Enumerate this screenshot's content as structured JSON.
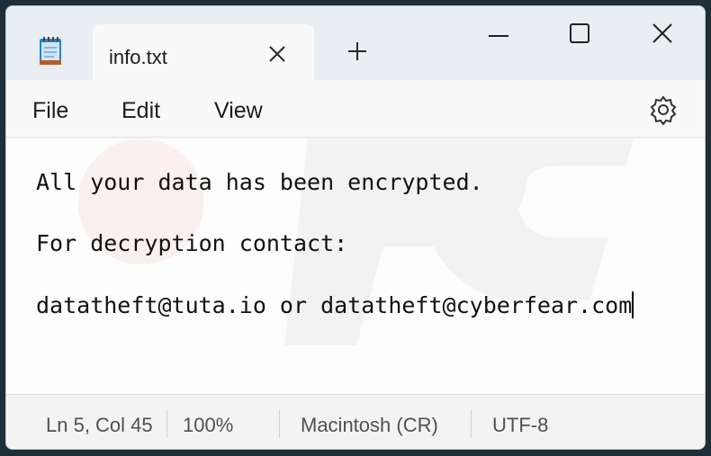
{
  "window": {
    "tab_title": "info.txt",
    "icons": {
      "app": "notepad-icon",
      "close_tab": "close-icon",
      "new_tab": "plus-icon",
      "minimize": "minimize-icon",
      "maximize": "maximize-icon",
      "close_window": "close-icon"
    }
  },
  "menu": {
    "file": "File",
    "edit": "Edit",
    "view": "View",
    "settings_icon": "gear-icon"
  },
  "document": {
    "lines": [
      "All your data has been encrypted.",
      "For decryption contact:",
      "datatheft@tuta.io or datatheft@cyberfear.com"
    ]
  },
  "status": {
    "position": "Ln 5, Col 45",
    "zoom": "100%",
    "line_ending": "Macintosh (CR)",
    "encoding": "UTF-8"
  },
  "colors": {
    "titlebar": "#e9eef3",
    "editor_bg": "#fdfdfd",
    "text": "#111111"
  }
}
